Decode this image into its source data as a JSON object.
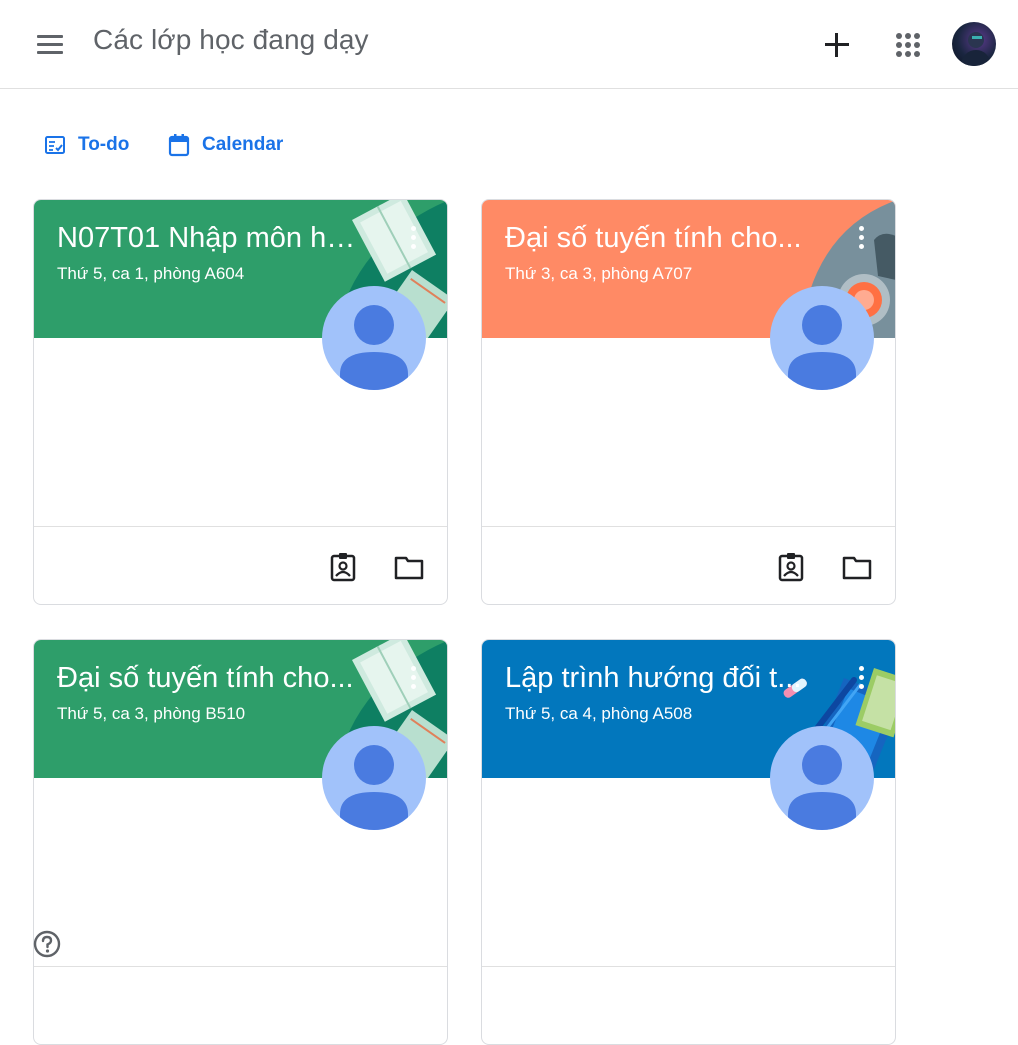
{
  "header": {
    "title": "Các lớp học đang dạy",
    "menu_icon": "hamburger-menu-icon",
    "add_icon": "plus-icon",
    "apps_icon": "google-apps-grid-icon",
    "avatar": "user-avatar"
  },
  "quick_links": [
    {
      "label": "To-do",
      "icon": "todo-checklist-icon"
    },
    {
      "label": "Calendar",
      "icon": "calendar-icon"
    }
  ],
  "classes": [
    {
      "title": "N07T01 Nhập môn hệ...",
      "subtitle": "Thứ 5, ca 1, phòng A604",
      "color": "#2e9e6a"
    },
    {
      "title": "Đại số tuyến tính cho...",
      "subtitle": "Thứ 3, ca 3, phòng A707",
      "color": "#ff8a65"
    },
    {
      "title": "Đại số tuyến tính cho...",
      "subtitle": "Thứ 5, ca 3, phòng B510",
      "color": "#2e9e6a"
    },
    {
      "title": "Lập trình hướng đối t...",
      "subtitle": "Thứ 5, ca 4, phòng A508",
      "color": "#0277bd"
    }
  ],
  "colors": {
    "accent": "#1a73e8",
    "green": "#2e9e6a",
    "orange": "#ff8a65",
    "blue": "#0277bd",
    "avatar_bg": "#a1c2fa",
    "avatar_fg": "#4a7be0"
  }
}
